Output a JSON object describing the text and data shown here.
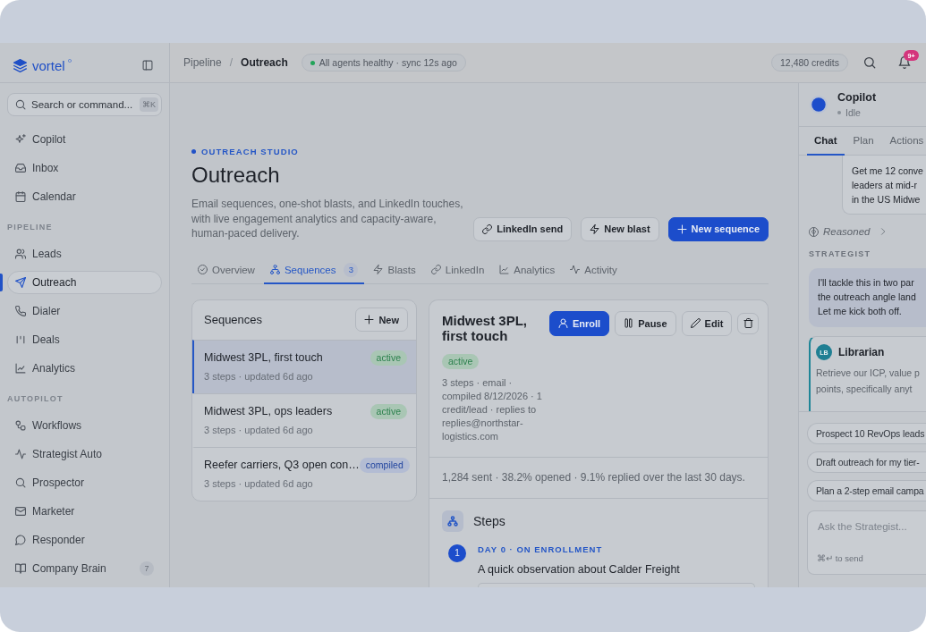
{
  "sidebar": {
    "brand": "vortel",
    "search": {
      "placeholder": "Search or command...",
      "shortcut": "⌘K"
    },
    "sections": [
      {
        "items": [
          {
            "label": "Copilot",
            "selected": false
          },
          {
            "label": "Inbox",
            "selected": false
          },
          {
            "label": "Calendar",
            "selected": false
          }
        ]
      },
      {
        "title": "PIPELINE",
        "items": [
          {
            "label": "Leads",
            "selected": false
          },
          {
            "label": "Outreach",
            "selected": true
          },
          {
            "label": "Dialer",
            "selected": false
          },
          {
            "label": "Deals",
            "selected": false
          },
          {
            "label": "Analytics",
            "selected": false
          }
        ]
      },
      {
        "title": "AUTOPILOT",
        "items": [
          {
            "label": "Workflows",
            "selected": false
          },
          {
            "label": "Strategist Auto",
            "selected": false
          },
          {
            "label": "Prospector",
            "selected": false
          },
          {
            "label": "Marketer",
            "selected": false
          },
          {
            "label": "Responder",
            "selected": false
          },
          {
            "label": "Company Brain",
            "selected": false,
            "badge": "7"
          }
        ]
      }
    ]
  },
  "topbar": {
    "breadcrumb": [
      "Pipeline",
      "Outreach"
    ],
    "separator": "/",
    "status": {
      "text": "All agents healthy · sync 12s ago",
      "healthy": true
    },
    "credits": "12,480 credits",
    "notifications": "9+"
  },
  "page": {
    "eyebrow": "OUTREACH STUDIO",
    "title": "Outreach",
    "description": "Email sequences, one-shot blasts, and LinkedIn touches, with live engagement analytics and capacity-aware, human-paced delivery.",
    "actions": [
      {
        "label": "LinkedIn send",
        "kind": "secondary"
      },
      {
        "label": "New blast",
        "kind": "secondary"
      },
      {
        "label": "New sequence",
        "kind": "primary"
      }
    ],
    "tabs": [
      {
        "label": "Overview",
        "selected": false
      },
      {
        "label": "Sequences",
        "count": "3",
        "selected": true
      },
      {
        "label": "Blasts",
        "selected": false
      },
      {
        "label": "LinkedIn",
        "selected": false
      },
      {
        "label": "Analytics",
        "selected": false
      },
      {
        "label": "Activity",
        "selected": false
      }
    ]
  },
  "sequences": {
    "title": "Sequences",
    "new_button": "New",
    "rows": [
      {
        "title": "Midwest 3PL, first touch",
        "meta": "3 steps · updated 6d ago",
        "badge": {
          "label": "active",
          "color": "#a9c6b4"
        },
        "selected": true
      },
      {
        "title": "Midwest 3PL, ops leaders",
        "meta": "3 steps · updated 6d ago",
        "badge": {
          "label": "active",
          "color": "#a9c6b4"
        },
        "selected": false
      },
      {
        "title": "Reefer carriers, Q3 open con…",
        "meta": "3 steps · updated 6d ago",
        "badge": {
          "label": "compiled",
          "color": "#b3bcd3"
        },
        "selected": false
      }
    ]
  },
  "detail": {
    "title": "Midwest 3PL, first touch",
    "badge": {
      "label": "active",
      "color": "#a9c6b4"
    },
    "meta": "3 steps · email · compiled 8/12/2026 · 1 credit/lead · replies to replies@northstar-logistics.com",
    "actions": [
      {
        "label": "Enroll",
        "kind": "primary"
      },
      {
        "label": "Pause",
        "kind": "secondary"
      },
      {
        "label": "Edit",
        "kind": "secondary"
      }
    ],
    "stats": "1,284 sent · 38.2% opened · 9.1% replied over the last 30 days.",
    "steps_title": "Steps",
    "steps": [
      {
        "number": "1",
        "timing": "DAY 0 · ON ENROLLMENT",
        "subject": "A quick observation about Calder Freight"
      }
    ]
  },
  "copilot": {
    "name": "Copilot",
    "status": "Idle",
    "tabs": [
      {
        "label": "Chat",
        "selected": true
      },
      {
        "label": "Plan",
        "selected": false
      },
      {
        "label": "Actions",
        "selected": false
      }
    ],
    "messages": [
      {
        "kind": "user",
        "lines": [
          "Get me 12 conve",
          "leaders at mid-r",
          "in the US Midwe"
        ]
      },
      {
        "kind": "reasoning",
        "label": "Reasoned",
        "expanded": false
      },
      {
        "kind": "sender",
        "label": "STRATEGIST"
      },
      {
        "kind": "assistant",
        "lines": [
          "I'll tackle this in two par",
          "the outreach angle land",
          "Let me kick both off."
        ]
      },
      {
        "kind": "agent",
        "initials": "LB",
        "name": "Librarian",
        "lines": [
          "Retrieve our ICP, value p",
          "points, specifically anyt"
        ]
      }
    ],
    "suggestions": [
      "Prospect 10 RevOps leads",
      "Draft outreach for my tier-",
      "Plan a 2-step email campa"
    ],
    "composer": {
      "placeholder": "Ask the Strategist...",
      "hint": "⌘↵ to send"
    }
  }
}
